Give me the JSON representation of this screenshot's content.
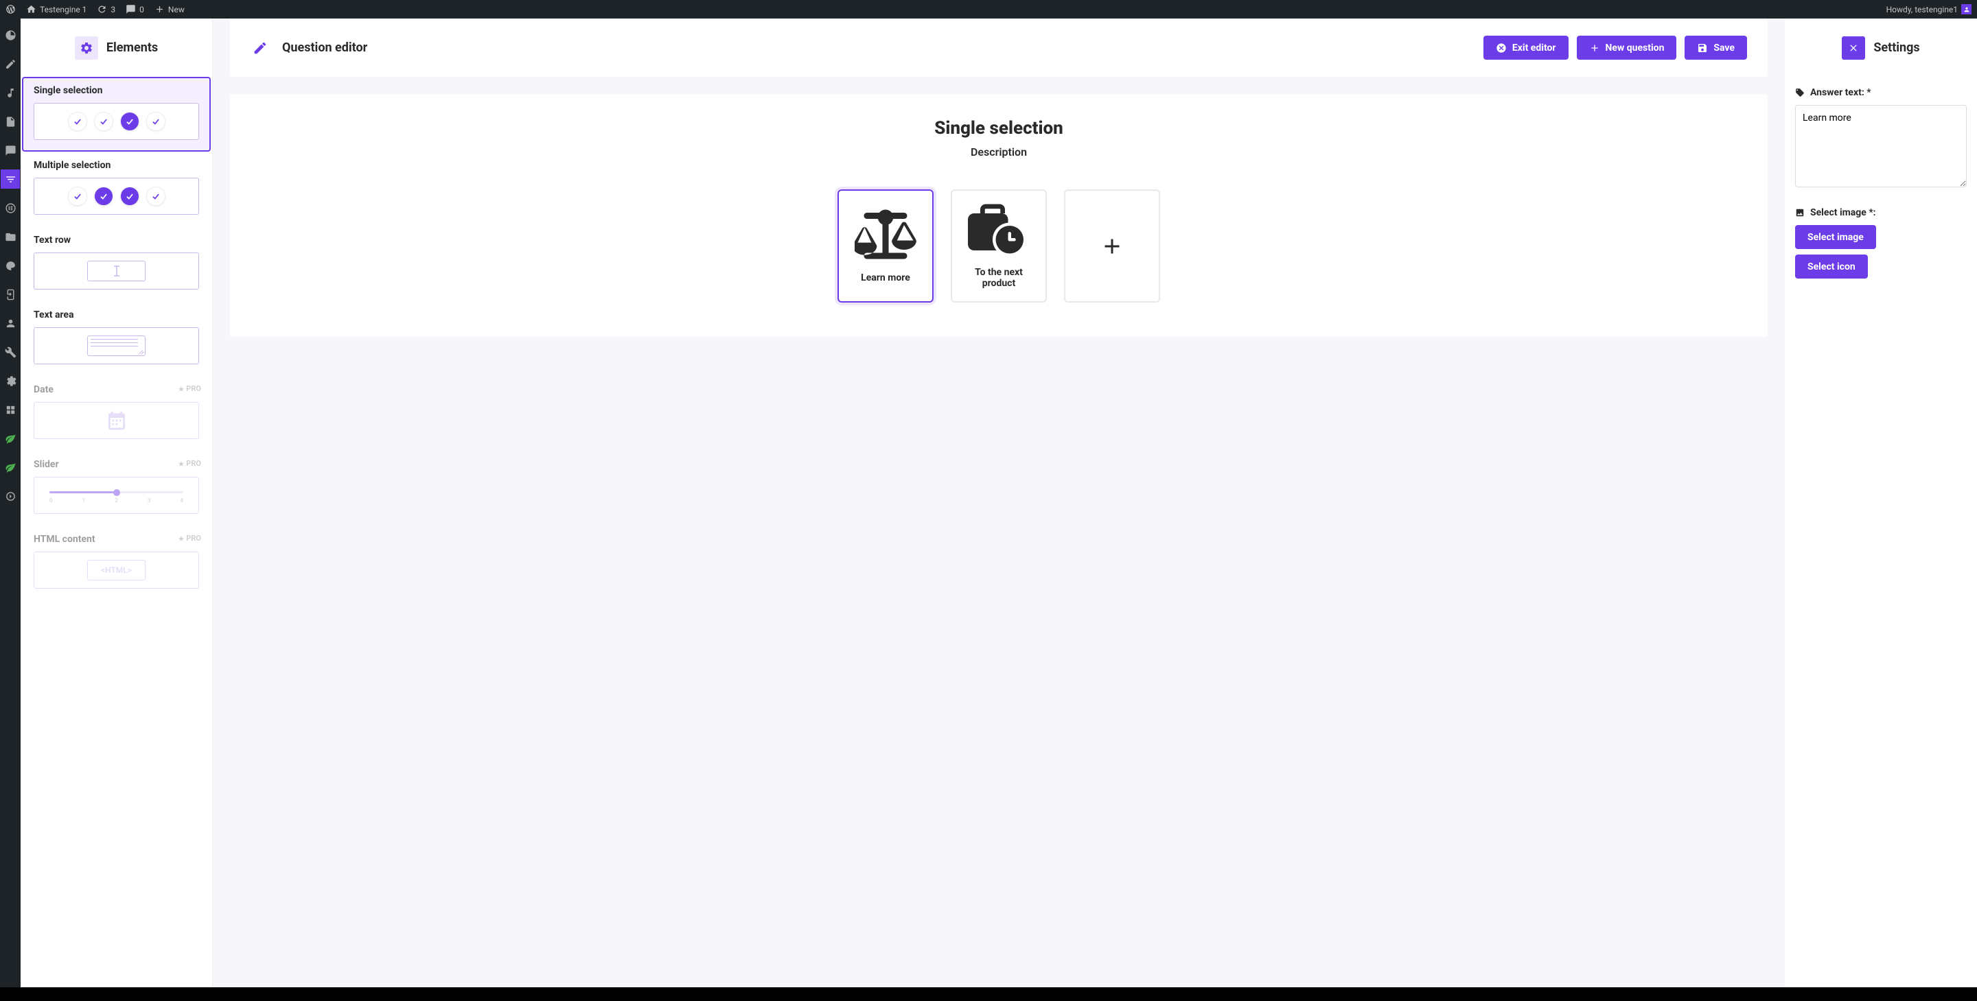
{
  "admin_bar": {
    "site_name": "Testengine 1",
    "updates_count": "3",
    "comments_count": "0",
    "new_label": "New",
    "howdy_prefix": "Howdy, ",
    "username": "testengine1"
  },
  "elements_panel": {
    "title": "Elements",
    "items": {
      "single_selection": "Single selection",
      "multiple_selection": "Multiple selection",
      "text_row": "Text row",
      "text_area": "Text area",
      "date": "Date",
      "slider": "Slider",
      "html_content": "HTML content",
      "pro_badge": "PRO",
      "slider_ticks": [
        "0",
        "1",
        "2",
        "3",
        "4"
      ],
      "html_preview": "<HTML>"
    }
  },
  "editor": {
    "title": "Question editor",
    "buttons": {
      "exit": "Exit editor",
      "new_question": "New question",
      "save": "Save"
    },
    "canvas": {
      "title": "Single selection",
      "description": "Description",
      "answers": [
        {
          "label": "Learn more"
        },
        {
          "label": "To the next product"
        }
      ]
    }
  },
  "settings_panel": {
    "title": "Settings",
    "answer_text_label": "Answer text: *",
    "answer_text_value": "Learn more",
    "select_image_label": "Select image *:",
    "select_image_btn": "Select image",
    "select_icon_btn": "Select icon"
  }
}
